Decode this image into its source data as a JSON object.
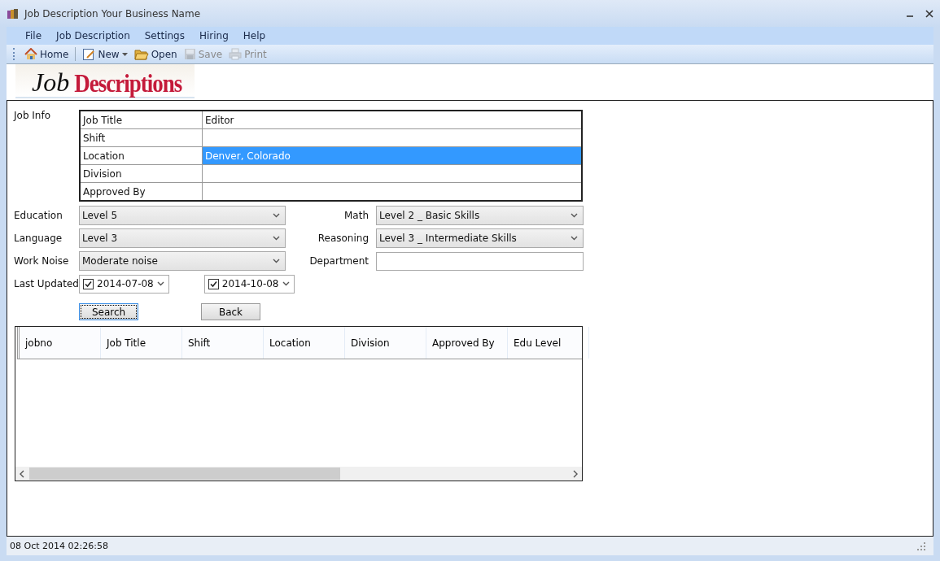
{
  "window": {
    "title": "Job Description Your Business Name"
  },
  "menu": [
    {
      "label": "File"
    },
    {
      "label": "Job Description"
    },
    {
      "label": "Settings"
    },
    {
      "label": "Hiring"
    },
    {
      "label": "Help"
    }
  ],
  "toolbar": [
    {
      "kind": "home",
      "label": "Home",
      "disabled": false
    },
    {
      "kind": "new",
      "label": "New",
      "disabled": false
    },
    {
      "kind": "open",
      "label": "Open",
      "disabled": false
    },
    {
      "kind": "save",
      "label": "Save",
      "disabled": true
    },
    {
      "kind": "print",
      "label": "Print",
      "disabled": true
    }
  ],
  "logo": {
    "first": "Job",
    "second": "Descriptions"
  },
  "job_info": {
    "label": "Job Info",
    "rows": [
      {
        "field": "Job Title",
        "value": "Editor",
        "selected": false
      },
      {
        "field": "Shift",
        "selected": false
      },
      {
        "field": "Location",
        "value": "Denver, Colorado",
        "selected": true
      },
      {
        "field": "Division",
        "selected": false
      },
      {
        "field": "Approved By",
        "selected": false
      }
    ]
  },
  "left_fields": [
    {
      "label": "Education",
      "value": "Level 5"
    },
    {
      "label": "Language",
      "value": "Level 3"
    },
    {
      "label": "Work Noise",
      "value": "Moderate noise"
    }
  ],
  "right_fields": [
    {
      "kind": "dropdown",
      "label": "Math",
      "value": "Level 2 _ Basic Skills"
    },
    {
      "kind": "dropdown",
      "label": "Reasoning",
      "value": "Level 3 _ Intermediate Skills"
    },
    {
      "kind": "text",
      "label": "Department"
    }
  ],
  "last_updated": {
    "label": "Last Updated",
    "dates": [
      {
        "value": "2014-07-08",
        "checked": true
      },
      {
        "value": "2014-10-08",
        "checked": true
      }
    ]
  },
  "buttons": [
    {
      "label": "Search",
      "focused": true
    },
    {
      "label": "Back",
      "focused": false
    }
  ],
  "table": {
    "columns": [
      "jobno",
      "Job Title",
      "Shift",
      "Location",
      "Division",
      "Approved By",
      "Edu Level"
    ]
  },
  "status_bar": {
    "text": "08 Oct 2014 02:26:58"
  }
}
